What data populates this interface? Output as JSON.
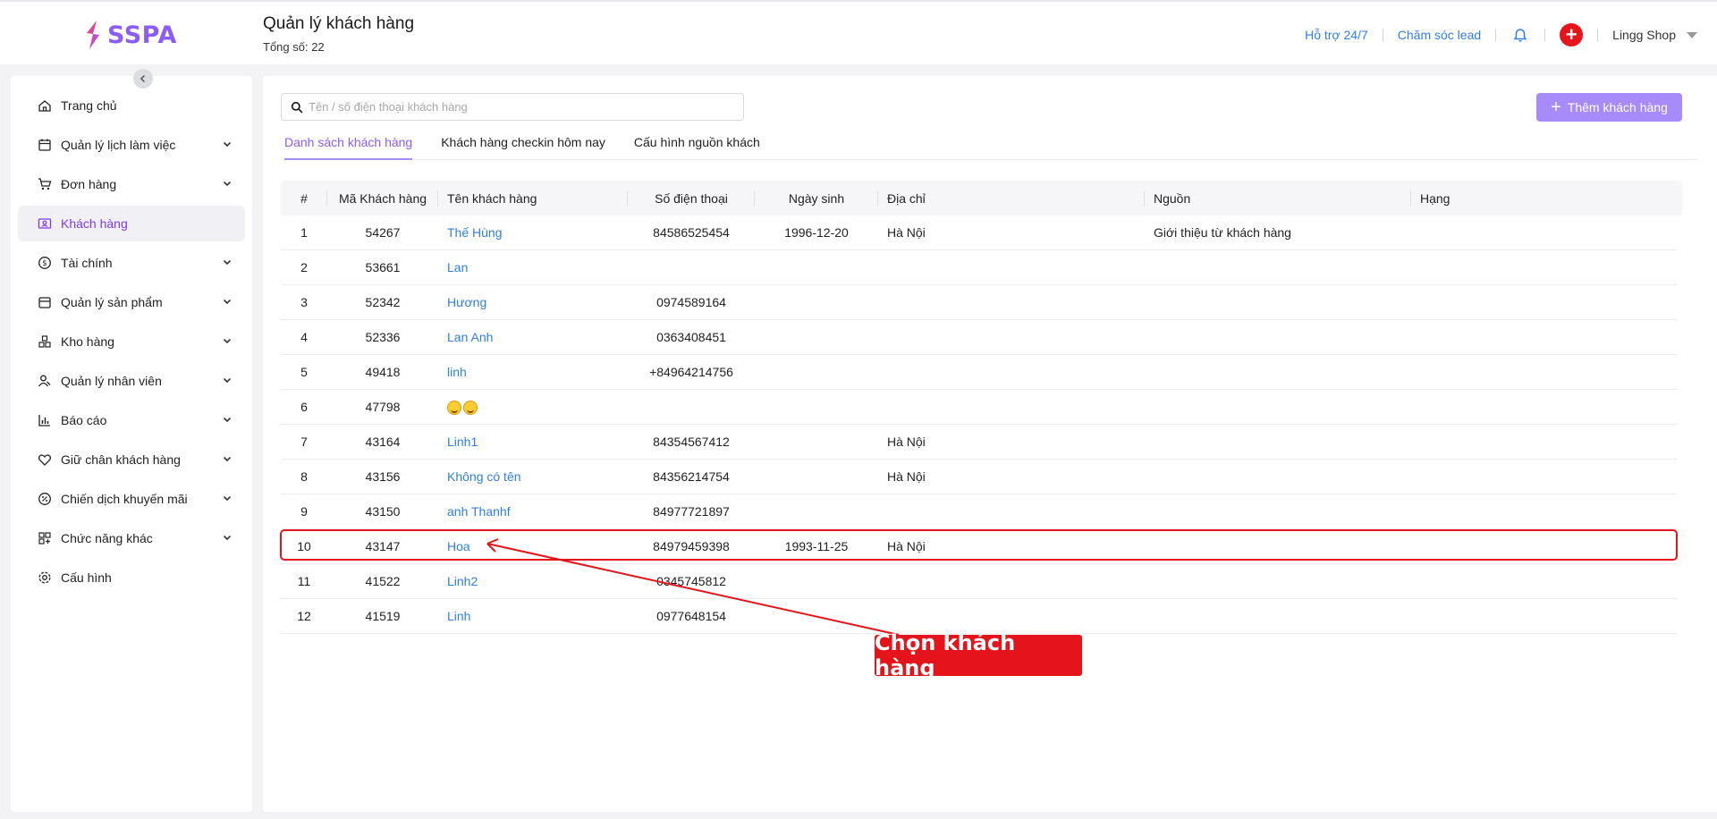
{
  "brand": {
    "name": "SSPA",
    "accent": "#8b5cf6",
    "logo_colors": [
      "#f43f5e",
      "#a855f7"
    ]
  },
  "header": {
    "title": "Quản lý khách hàng",
    "subtitle": "Tổng số: 22",
    "links": [
      "Hỗ trợ 24/7",
      "Chăm sóc lead"
    ],
    "bell_icon": "bell-icon",
    "plus_icon": "plus-circle-icon",
    "shop_name": "Lingg Shop"
  },
  "sidebar": {
    "items": [
      {
        "label": "Trang chủ",
        "icon": "home-icon",
        "expandable": false,
        "active": false
      },
      {
        "label": "Quản lý lịch làm việc",
        "icon": "calendar-icon",
        "expandable": true,
        "active": false
      },
      {
        "label": "Đơn hàng",
        "icon": "cart-icon",
        "expandable": true,
        "active": false
      },
      {
        "label": "Khách hàng",
        "icon": "customer-card-icon",
        "expandable": false,
        "active": true
      },
      {
        "label": "Tài chính",
        "icon": "dollar-circle-icon",
        "expandable": true,
        "active": false
      },
      {
        "label": "Quản lý sản phẩm",
        "icon": "box-icon",
        "expandable": true,
        "active": false
      },
      {
        "label": "Kho hàng",
        "icon": "warehouse-icon",
        "expandable": true,
        "active": false
      },
      {
        "label": "Quản lý nhân viên",
        "icon": "staff-icon",
        "expandable": true,
        "active": false
      },
      {
        "label": "Báo cáo",
        "icon": "bar-chart-icon",
        "expandable": true,
        "active": false
      },
      {
        "label": "Giữ chân khách hàng",
        "icon": "heart-icon",
        "expandable": true,
        "active": false
      },
      {
        "label": "Chiến dịch khuyến mãi",
        "icon": "discount-icon",
        "expandable": true,
        "active": false
      },
      {
        "label": "Chức năng khác",
        "icon": "grid-icon",
        "expandable": true,
        "active": false
      },
      {
        "label": "Cấu hình",
        "icon": "gear-icon",
        "expandable": false,
        "active": false
      }
    ]
  },
  "search": {
    "placeholder": "Tên / số điện thoại khách hàng",
    "value": ""
  },
  "add_button": {
    "label": "Thêm khách hàng"
  },
  "tabs": [
    {
      "label": "Danh sách khách hàng",
      "active": true
    },
    {
      "label": "Khách hàng checkin hôm nay",
      "active": false
    },
    {
      "label": "Cấu hình nguồn khách",
      "active": false
    }
  ],
  "table": {
    "columns": [
      "#",
      "Mã Khách hàng",
      "Tên khách hàng",
      "Số điện thoại",
      "Ngày sinh",
      "Địa chỉ",
      "Nguồn",
      "Hạng"
    ],
    "rows": [
      {
        "idx": "1",
        "code": "54267",
        "name": "Thế Hùng",
        "phone": "84586525454",
        "dob": "1996-12-20",
        "address": "Hà Nội",
        "source": "Giới thiệu từ khách hàng",
        "rank": ""
      },
      {
        "idx": "2",
        "code": "53661",
        "name": "Lan",
        "phone": "",
        "dob": "",
        "address": "",
        "source": "",
        "rank": ""
      },
      {
        "idx": "3",
        "code": "52342",
        "name": "Hương",
        "phone": "0974589164",
        "dob": "",
        "address": "",
        "source": "",
        "rank": ""
      },
      {
        "idx": "4",
        "code": "52336",
        "name": "Lan Anh",
        "phone": "0363408451",
        "dob": "",
        "address": "",
        "source": "",
        "rank": ""
      },
      {
        "idx": "5",
        "code": "49418",
        "name": "linh",
        "phone": "+84964214756",
        "dob": "",
        "address": "",
        "source": "",
        "rank": ""
      },
      {
        "idx": "6",
        "code": "47798",
        "name": "",
        "name_emoji": "rofl-emoji x2",
        "phone": "",
        "dob": "",
        "address": "",
        "source": "",
        "rank": ""
      },
      {
        "idx": "7",
        "code": "43164",
        "name": "Linh1",
        "phone": "84354567412",
        "dob": "",
        "address": "Hà Nội",
        "source": "",
        "rank": ""
      },
      {
        "idx": "8",
        "code": "43156",
        "name": "Không có tên",
        "phone": "84356214754",
        "dob": "",
        "address": "Hà Nội",
        "source": "",
        "rank": ""
      },
      {
        "idx": "9",
        "code": "43150",
        "name": "anh Thanhf",
        "phone": "84977721897",
        "dob": "",
        "address": "",
        "source": "",
        "rank": ""
      },
      {
        "idx": "10",
        "code": "43147",
        "name": "Hoa",
        "phone": "84979459398",
        "dob": "1993-11-25",
        "address": "Hà Nội",
        "source": "",
        "rank": ""
      },
      {
        "idx": "11",
        "code": "41522",
        "name": "Linh2",
        "phone": "0345745812",
        "dob": "",
        "address": "",
        "source": "",
        "rank": ""
      },
      {
        "idx": "12",
        "code": "41519",
        "name": "Linh",
        "phone": "0977648154",
        "dob": "",
        "address": "",
        "source": "",
        "rank": ""
      }
    ]
  },
  "annotation": {
    "label": "Chọn khách hàng",
    "color": "#e5141a",
    "highlighted_row": "10"
  }
}
